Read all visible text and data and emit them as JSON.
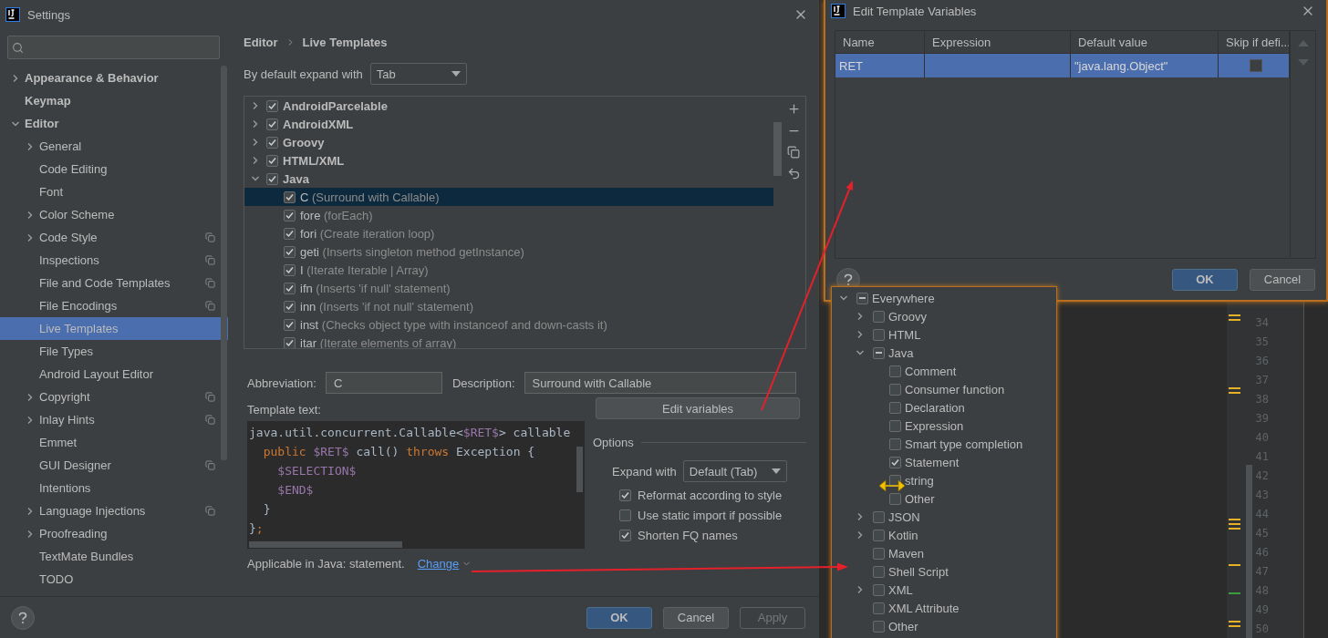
{
  "settings_window": {
    "title": "Settings",
    "sidebar": {
      "items": [
        {
          "label": "Appearance & Behavior",
          "expanded": false,
          "project_icon": false,
          "selected": false
        },
        {
          "label": "Keymap",
          "project_icon": false,
          "selected": false
        },
        {
          "label": "Editor",
          "expanded": true,
          "project_icon": false,
          "selected": false,
          "children": [
            {
              "label": "General",
              "expanded": false,
              "project_icon": false,
              "selected": false
            },
            {
              "label": "Code Editing",
              "project_icon": false,
              "selected": false
            },
            {
              "label": "Font",
              "project_icon": false,
              "selected": false
            },
            {
              "label": "Color Scheme",
              "expanded": false,
              "project_icon": false,
              "selected": false
            },
            {
              "label": "Code Style",
              "expanded": false,
              "project_icon": true,
              "selected": false
            },
            {
              "label": "Inspections",
              "project_icon": true,
              "selected": false
            },
            {
              "label": "File and Code Templates",
              "project_icon": true,
              "selected": false
            },
            {
              "label": "File Encodings",
              "project_icon": true,
              "selected": false
            },
            {
              "label": "Live Templates",
              "project_icon": false,
              "selected": true
            },
            {
              "label": "File Types",
              "project_icon": false,
              "selected": false
            },
            {
              "label": "Android Layout Editor",
              "project_icon": false,
              "selected": false
            },
            {
              "label": "Copyright",
              "expanded": false,
              "project_icon": true,
              "selected": false
            },
            {
              "label": "Inlay Hints",
              "expanded": false,
              "project_icon": true,
              "selected": false
            },
            {
              "label": "Emmet",
              "project_icon": false,
              "selected": false
            },
            {
              "label": "GUI Designer",
              "project_icon": true,
              "selected": false
            },
            {
              "label": "Intentions",
              "project_icon": false,
              "selected": false
            },
            {
              "label": "Language Injections",
              "expanded": false,
              "project_icon": true,
              "selected": false
            },
            {
              "label": "Proofreading",
              "expanded": false,
              "project_icon": false,
              "selected": false
            },
            {
              "label": "TextMate Bundles",
              "project_icon": false,
              "selected": false
            },
            {
              "label": "TODO",
              "project_icon": false,
              "selected": false
            }
          ]
        }
      ]
    },
    "breadcrumb": [
      "Editor",
      "Live Templates"
    ],
    "default_expand": {
      "label": "By default expand with",
      "value": "Tab"
    },
    "template_groups": [
      {
        "name": "AndroidParcelable",
        "checked": true,
        "expanded": false
      },
      {
        "name": "AndroidXML",
        "checked": true,
        "expanded": false
      },
      {
        "name": "Groovy",
        "checked": true,
        "expanded": false
      },
      {
        "name": "HTML/XML",
        "checked": true,
        "expanded": false
      },
      {
        "name": "Java",
        "checked": true,
        "expanded": true,
        "templates": [
          {
            "abbreviation": "C",
            "description": "(Surround with Callable)",
            "checked": true,
            "selected": true
          },
          {
            "abbreviation": "fore",
            "description": "(forEach)",
            "checked": true,
            "selected": false
          },
          {
            "abbreviation": "fori",
            "description": "(Create iteration loop)",
            "checked": true,
            "selected": false
          },
          {
            "abbreviation": "geti",
            "description": "(Inserts singleton method getInstance)",
            "checked": true,
            "selected": false
          },
          {
            "abbreviation": "I",
            "description": "(Iterate Iterable | Array)",
            "checked": true,
            "selected": false
          },
          {
            "abbreviation": "ifn",
            "description": "(Inserts 'if null' statement)",
            "checked": true,
            "selected": false
          },
          {
            "abbreviation": "inn",
            "description": "(Inserts 'if not null' statement)",
            "checked": true,
            "selected": false
          },
          {
            "abbreviation": "inst",
            "description": "(Checks object type with instanceof and down-casts it)",
            "checked": true,
            "selected": false
          },
          {
            "abbreviation": "itar",
            "description": "(Iterate elements of array)",
            "checked": true,
            "selected": false
          }
        ]
      }
    ],
    "abbreviation": {
      "label": "Abbreviation:",
      "value": "C"
    },
    "description": {
      "label": "Description:",
      "value": "Surround with Callable"
    },
    "template_text": {
      "label": "Template text:",
      "lines": [
        [
          {
            "kind": "plain",
            "text": "java.util.concurrent.Callable<"
          },
          {
            "kind": "variable",
            "text": "$RET$"
          },
          {
            "kind": "plain",
            "text": "> callable"
          }
        ],
        [
          {
            "kind": "keyword",
            "text": "  public"
          },
          {
            "kind": "variable",
            "text": " $RET$"
          },
          {
            "kind": "plain",
            "text": " call() "
          },
          {
            "kind": "keyword",
            "text": "throws"
          },
          {
            "kind": "plain",
            "text": " Exception {"
          }
        ],
        [
          {
            "kind": "variable",
            "text": "    $SELECTION$"
          }
        ],
        [
          {
            "kind": "variable",
            "text": "    $END$"
          }
        ],
        [
          {
            "kind": "plain",
            "text": "  }"
          }
        ],
        [
          {
            "kind": "plain",
            "text": "}"
          },
          {
            "kind": "keyword",
            "text": ";"
          }
        ]
      ]
    },
    "edit_variables_button": "Edit variables",
    "options": {
      "title": "Options",
      "expand_with": {
        "label": "Expand with",
        "value": "Default (Tab)"
      },
      "checkboxes": [
        {
          "label": "Reformat according to style",
          "checked": true
        },
        {
          "label": "Use static import if possible",
          "checked": false
        },
        {
          "label": "Shorten FQ names",
          "checked": true
        }
      ]
    },
    "applicable": {
      "text": "Applicable in Java: statement.",
      "link": "Change"
    },
    "buttons": [
      {
        "label": "OK",
        "primary": true,
        "disabled": false
      },
      {
        "label": "Cancel",
        "primary": false,
        "disabled": false
      },
      {
        "label": "Apply",
        "primary": false,
        "disabled": true
      }
    ]
  },
  "variables_dialog": {
    "title": "Edit Template Variables",
    "columns": [
      "Name",
      "Expression",
      "Default value",
      "Skip if defi..."
    ],
    "rows": [
      {
        "name": "RET",
        "default_value": "\"java.lang.Object\"",
        "skip_if_defined": false,
        "selected": true
      }
    ],
    "buttons": [
      {
        "label": "OK",
        "primary": true
      },
      {
        "label": "Cancel",
        "primary": false
      }
    ]
  },
  "context_popup": {
    "items": [
      {
        "label": "Everywhere",
        "checked": true,
        "partial": true,
        "expanded": true,
        "children": [
          {
            "label": "Groovy",
            "checked": false,
            "expanded": false
          },
          {
            "label": "HTML",
            "checked": false,
            "expanded": false
          },
          {
            "label": "Java",
            "checked": true,
            "partial": true,
            "expanded": true,
            "children": [
              {
                "label": "Comment",
                "checked": false
              },
              {
                "label": "Consumer function",
                "checked": false
              },
              {
                "label": "Declaration",
                "checked": false
              },
              {
                "label": "Expression",
                "checked": false
              },
              {
                "label": "Smart type completion",
                "checked": false
              },
              {
                "label": "Statement",
                "checked": true
              },
              {
                "label": "string",
                "checked": false
              },
              {
                "label": "Other",
                "checked": false
              }
            ]
          },
          {
            "label": "JSON",
            "checked": false,
            "expanded": false
          },
          {
            "label": "Kotlin",
            "checked": false,
            "expanded": false
          },
          {
            "label": "Maven",
            "checked": false
          },
          {
            "label": "Shell Script",
            "checked": false
          },
          {
            "label": "XML",
            "checked": false,
            "expanded": false
          },
          {
            "label": "XML Attribute",
            "checked": false
          },
          {
            "label": "Other",
            "checked": false
          }
        ]
      }
    ]
  },
  "editor": {
    "line_numbers": [
      "34",
      "35",
      "36",
      "37",
      "38",
      "39",
      "40",
      "41",
      "42",
      "43",
      "44",
      "45",
      "46",
      "47",
      "48",
      "49",
      "50"
    ]
  }
}
